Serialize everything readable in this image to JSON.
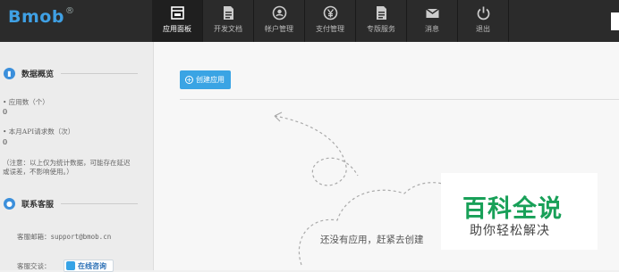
{
  "brand": {
    "name": "Bmob",
    "mark": "®",
    "color": "#3fa0e4"
  },
  "nav": {
    "items": [
      {
        "label": "应用面板",
        "icon": "panel-icon",
        "active": true
      },
      {
        "label": "开发文档",
        "icon": "document-icon",
        "active": false
      },
      {
        "label": "帐户管理",
        "icon": "account-icon",
        "active": false
      },
      {
        "label": "支付管理",
        "icon": "yen-icon",
        "active": false
      },
      {
        "label": "专版服务",
        "icon": "service-doc-icon",
        "active": false
      },
      {
        "label": "消息",
        "icon": "mail-icon",
        "active": false
      },
      {
        "label": "退出",
        "icon": "power-icon",
        "active": false
      }
    ]
  },
  "sidebar": {
    "stats": {
      "title": "数据概览",
      "app_count_label": "• 应用数（个）",
      "app_count_value": "0",
      "api_label": "• 本月API请求数（次）",
      "api_value": "0",
      "note_line1": "（注意：以上仅为统计数据，可能存在延迟",
      "note_line2": "或误差，不影响使用。）"
    },
    "support": {
      "title": "联系客服",
      "email_label": "客服邮箱：",
      "email_value": "support@bmob.cn",
      "qq_label": "客服交谈：",
      "consult_label": "在线咨询"
    }
  },
  "main": {
    "create_button": "创建应用",
    "empty_message": "还没有应用，赶紧去创建"
  },
  "watermark": {
    "title": "百科全说",
    "subtitle": "助你轻松解决",
    "color": "#18a058"
  }
}
